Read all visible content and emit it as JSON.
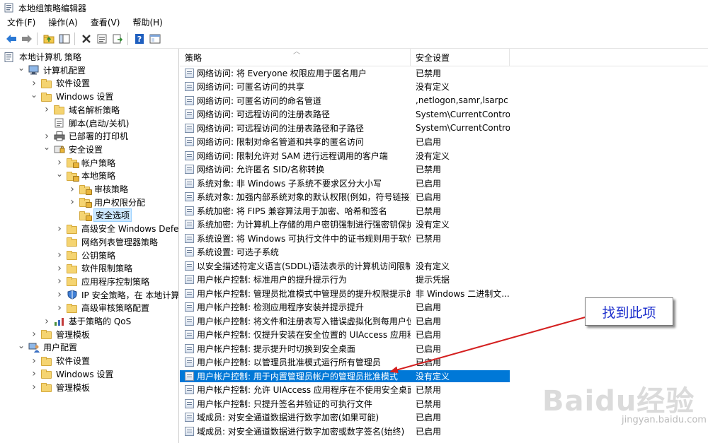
{
  "window": {
    "title": "本地组策略编辑器"
  },
  "menu": [
    "文件(F)",
    "操作(A)",
    "查看(V)",
    "帮助(H)"
  ],
  "toolbar": [
    "back-icon",
    "forward-icon",
    "up-folder-icon",
    "show-hide-tree-icon",
    "delete-icon",
    "properties-icon",
    "export-list-icon",
    "help-icon",
    "view-icon"
  ],
  "tree": [
    {
      "label": "本地计算机 策略",
      "level": 0,
      "expander": "",
      "icon": "policy"
    },
    {
      "label": "计算机配置",
      "level": 1,
      "expander": "v",
      "icon": "computer"
    },
    {
      "label": "软件设置",
      "level": 2,
      "expander": ">",
      "icon": "folder"
    },
    {
      "label": "Windows 设置",
      "level": 2,
      "expander": "v",
      "icon": "folder"
    },
    {
      "label": "域名解析策略",
      "level": 3,
      "expander": ">",
      "icon": "folder"
    },
    {
      "label": "脚本(启动/关机)",
      "level": 3,
      "expander": "",
      "icon": "script"
    },
    {
      "label": "已部署的打印机",
      "level": 3,
      "expander": ">",
      "icon": "printer"
    },
    {
      "label": "安全设置",
      "level": 3,
      "expander": "v",
      "icon": "security"
    },
    {
      "label": "帐户策略",
      "level": 4,
      "expander": ">",
      "icon": "lockfolder"
    },
    {
      "label": "本地策略",
      "level": 4,
      "expander": "v",
      "icon": "lockfolder"
    },
    {
      "label": "审核策略",
      "level": 5,
      "expander": ">",
      "icon": "lockfolder"
    },
    {
      "label": "用户权限分配",
      "level": 5,
      "expander": ">",
      "icon": "lockfolder"
    },
    {
      "label": "安全选项",
      "level": 5,
      "expander": "",
      "icon": "lockfolder",
      "selected": true
    },
    {
      "label": "高级安全 Windows Defender",
      "level": 4,
      "expander": ">",
      "icon": "folder"
    },
    {
      "label": "网络列表管理器策略",
      "level": 4,
      "expander": "",
      "icon": "folder"
    },
    {
      "label": "公钥策略",
      "level": 4,
      "expander": ">",
      "icon": "folder"
    },
    {
      "label": "软件限制策略",
      "level": 4,
      "expander": ">",
      "icon": "folder"
    },
    {
      "label": "应用程序控制策略",
      "level": 4,
      "expander": ">",
      "icon": "folder"
    },
    {
      "label": "IP 安全策略，在 本地计算机",
      "level": 4,
      "expander": ">",
      "icon": "shield"
    },
    {
      "label": "高级审核策略配置",
      "level": 4,
      "expander": ">",
      "icon": "folder"
    },
    {
      "label": "基于策略的 QoS",
      "level": 3,
      "expander": ">",
      "icon": "chart"
    },
    {
      "label": "管理模板",
      "level": 2,
      "expander": ">",
      "icon": "folder"
    },
    {
      "label": "用户配置",
      "level": 1,
      "expander": "v",
      "icon": "user"
    },
    {
      "label": "软件设置",
      "level": 2,
      "expander": ">",
      "icon": "folder"
    },
    {
      "label": "Windows 设置",
      "level": 2,
      "expander": ">",
      "icon": "folder"
    },
    {
      "label": "管理模板",
      "level": 2,
      "expander": ">",
      "icon": "folder"
    }
  ],
  "list": {
    "columns": [
      "策略",
      "安全设置"
    ],
    "rows": [
      {
        "policy": "网络访问: 将 Everyone 权限应用于匿名用户",
        "setting": "已禁用"
      },
      {
        "policy": "网络访问: 可匿名访问的共享",
        "setting": "没有定义"
      },
      {
        "policy": "网络访问: 可匿名访问的命名管道",
        "setting": ",netlogon,samr,lsarpc"
      },
      {
        "policy": "网络访问: 可远程访问的注册表路径",
        "setting": "System\\CurrentContro..."
      },
      {
        "policy": "网络访问: 可远程访问的注册表路径和子路径",
        "setting": "System\\CurrentContro..."
      },
      {
        "policy": "网络访问: 限制对命名管道和共享的匿名访问",
        "setting": "已启用"
      },
      {
        "policy": "网络访问: 限制允许对 SAM 进行远程调用的客户端",
        "setting": "没有定义"
      },
      {
        "policy": "网络访问: 允许匿名 SID/名称转换",
        "setting": "已禁用"
      },
      {
        "policy": "系统对象: 非 Windows 子系统不要求区分大小写",
        "setting": "已启用"
      },
      {
        "policy": "系统对象: 加强内部系统对象的默认权限(例如，符号链接)",
        "setting": "已启用"
      },
      {
        "policy": "系统加密: 将 FIPS 兼容算法用于加密、哈希和签名",
        "setting": "已禁用"
      },
      {
        "policy": "系统加密: 为计算机上存储的用户密钥强制进行强密钥保护",
        "setting": "没有定义"
      },
      {
        "policy": "系统设置: 将 Windows 可执行文件中的证书规则用于软件...",
        "setting": "已禁用"
      },
      {
        "policy": "系统设置: 可选子系统",
        "setting": ""
      },
      {
        "policy": "以安全描述符定义语言(SDDL)语法表示的计算机访问限制",
        "setting": "没有定义"
      },
      {
        "policy": "用户帐户控制: 标准用户的提升提示行为",
        "setting": "提示凭据"
      },
      {
        "policy": "用户帐户控制: 管理员批准模式中管理员的提升权限提示的...",
        "setting": "非 Windows 二进制文..."
      },
      {
        "policy": "用户帐户控制: 检测应用程序安装并提示提升",
        "setting": "已启用"
      },
      {
        "policy": "用户帐户控制: 将文件和注册表写入错误虚拟化到每用户位置",
        "setting": "已启用"
      },
      {
        "policy": "用户帐户控制: 仅提升安装在安全位置的 UIAccess 应用程序",
        "setting": "已启用"
      },
      {
        "policy": "用户帐户控制: 提示提升时切换到安全桌面",
        "setting": "已启用"
      },
      {
        "policy": "用户帐户控制: 以管理员批准模式运行所有管理员",
        "setting": "已启用"
      },
      {
        "policy": "用户帐户控制: 用于内置管理员帐户的管理员批准模式",
        "setting": "没有定义",
        "selected": true
      },
      {
        "policy": "用户帐户控制: 允许 UIAccess 应用程序在不使用安全桌面...",
        "setting": "已禁用"
      },
      {
        "policy": "用户帐户控制: 只提升签名并验证的可执行文件",
        "setting": "已禁用"
      },
      {
        "policy": "域成员: 对安全通道数据进行数字加密(如果可能)",
        "setting": "已启用"
      },
      {
        "policy": "域成员: 对安全通道数据进行数字加密或数字签名(始终)",
        "setting": "已启用"
      }
    ]
  },
  "annotation": {
    "text": "找到此项",
    "color": "#1a2ccc",
    "arrow_color": "#d42020"
  },
  "watermark": {
    "brand": "Baidu经验",
    "url": "jingyan.baidu.com"
  },
  "colors": {
    "selection": "#0078d7",
    "tree_selection": "#cce8ff"
  }
}
